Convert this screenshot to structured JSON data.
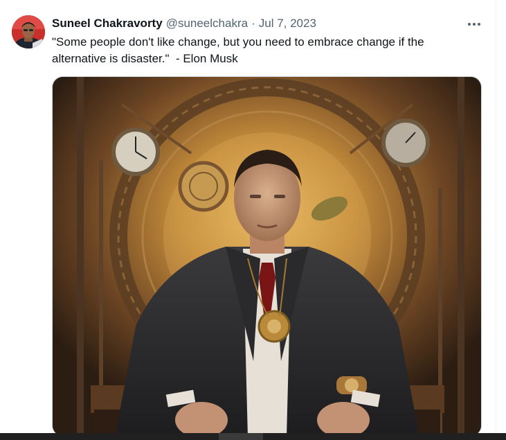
{
  "tweet": {
    "display_name": "Suneel Chakravorty",
    "handle": "@suneelchakra",
    "separator": "·",
    "date": "Jul 7, 2023",
    "more_icon": "more-horizontal-icon",
    "text": "\"Some people don't like change, but you need to embrace change if the alternative is disaster.\"  - Elon Musk"
  },
  "colors": {
    "text_primary": "#0f1419",
    "text_secondary": "#536471",
    "border": "#cfd9de",
    "taskbar": "#202020"
  }
}
